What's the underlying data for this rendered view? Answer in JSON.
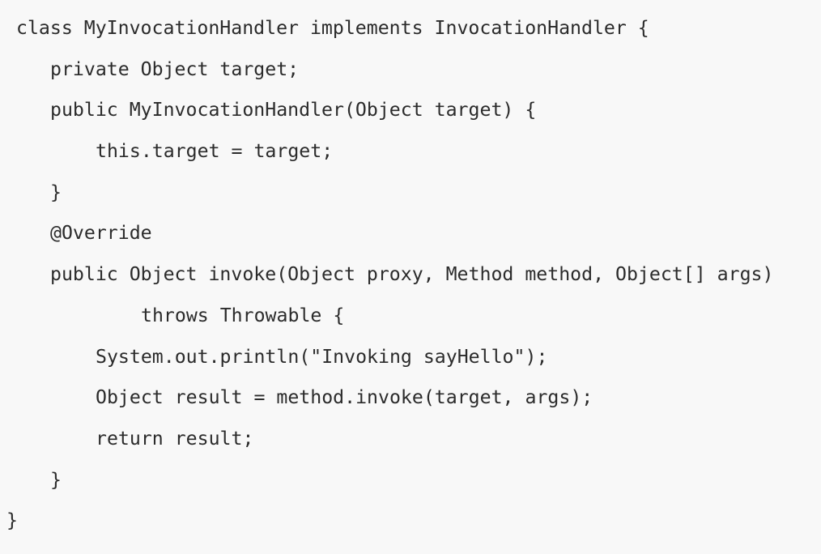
{
  "code": {
    "lines": [
      {
        "indent": 20,
        "text": "class MyInvocationHandler implements InvocationHandler {"
      },
      {
        "indent": 62,
        "text": "private Object target;"
      },
      {
        "indent": 62,
        "text": "public MyInvocationHandler(Object target) {"
      },
      {
        "indent": 118,
        "text": "this.target = target;"
      },
      {
        "indent": 62,
        "text": "}"
      },
      {
        "indent": 62,
        "text": "@Override"
      },
      {
        "indent": 62,
        "text": "public Object invoke(Object proxy, Method method, Object[] args)"
      },
      {
        "indent": 174,
        "text": "throws Throwable {"
      },
      {
        "indent": 118,
        "text": "System.out.println(\"Invoking sayHello\");"
      },
      {
        "indent": 118,
        "text": "Object result = method.invoke(target, args);"
      },
      {
        "indent": 118,
        "text": "return result;"
      },
      {
        "indent": 62,
        "text": "}"
      },
      {
        "indent": 8,
        "text": "}"
      }
    ]
  }
}
